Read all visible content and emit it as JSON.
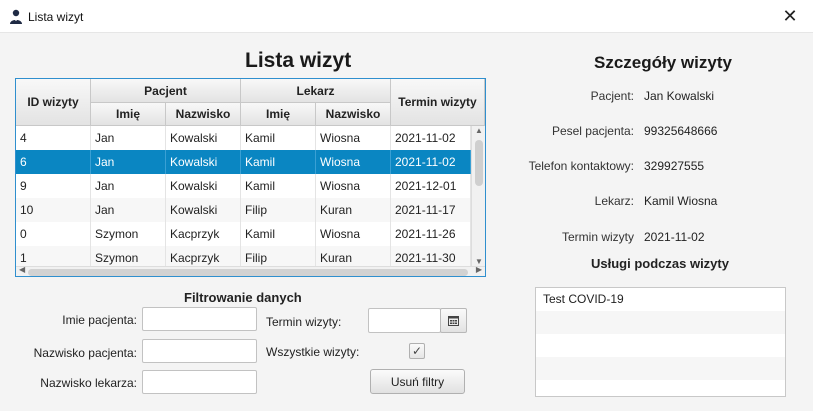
{
  "window": {
    "title": "Lista wizyt",
    "close_glyph": "✕"
  },
  "main": {
    "heading": "Lista wizyt"
  },
  "table": {
    "headers": {
      "id": "ID wizyty",
      "patient_group": "Pacjent",
      "doctor_group": "Lekarz",
      "date": "Termin wizyty",
      "first_name": "Imię",
      "last_name": "Nazwisko"
    },
    "rows": [
      {
        "id": "4",
        "p_first": "Jan",
        "p_last": "Kowalski",
        "d_first": "Kamil",
        "d_last": "Wiosna",
        "date": "2021-11-02"
      },
      {
        "id": "6",
        "p_first": "Jan",
        "p_last": "Kowalski",
        "d_first": "Kamil",
        "d_last": "Wiosna",
        "date": "2021-11-02"
      },
      {
        "id": "9",
        "p_first": "Jan",
        "p_last": "Kowalski",
        "d_first": "Kamil",
        "d_last": "Wiosna",
        "date": "2021-12-01"
      },
      {
        "id": "10",
        "p_first": "Jan",
        "p_last": "Kowalski",
        "d_first": "Filip",
        "d_last": "Kuran",
        "date": "2021-11-17"
      },
      {
        "id": "0",
        "p_first": "Szymon",
        "p_last": "Kacprzyk",
        "d_first": "Kamil",
        "d_last": "Wiosna",
        "date": "2021-11-26"
      },
      {
        "id": "1",
        "p_first": "Szymon",
        "p_last": "Kacprzyk",
        "d_first": "Filip",
        "d_last": "Kuran",
        "date": "2021-11-30"
      }
    ],
    "selected_index": 1
  },
  "filter": {
    "title": "Filtrowanie danych",
    "patient_first_label": "Imie pacjenta:",
    "patient_last_label": "Nazwisko pacjenta:",
    "doctor_last_label": "Nazwisko lekarza:",
    "date_label": "Termin wizyty:",
    "all_visits_label": "Wszystkie wizyty:",
    "all_visits_checked": true,
    "clear_button": "Usuń filtry",
    "patient_first_value": "",
    "patient_last_value": "",
    "doctor_last_value": "",
    "date_value": ""
  },
  "details": {
    "title": "Szczegóły wizyty",
    "patient_label": "Pacjent:",
    "patient_value": "Jan Kowalski",
    "pesel_label": "Pesel pacjenta:",
    "pesel_value": "99325648666",
    "phone_label": "Telefon kontaktowy:",
    "phone_value": "329927555",
    "doctor_label": "Lekarz:",
    "doctor_value": "Kamil Wiosna",
    "date_label": "Termin wizyty",
    "date_value": "2021-11-02",
    "services_title": "Usługi podczas wizyty",
    "services": [
      "Test COVID-19"
    ]
  }
}
